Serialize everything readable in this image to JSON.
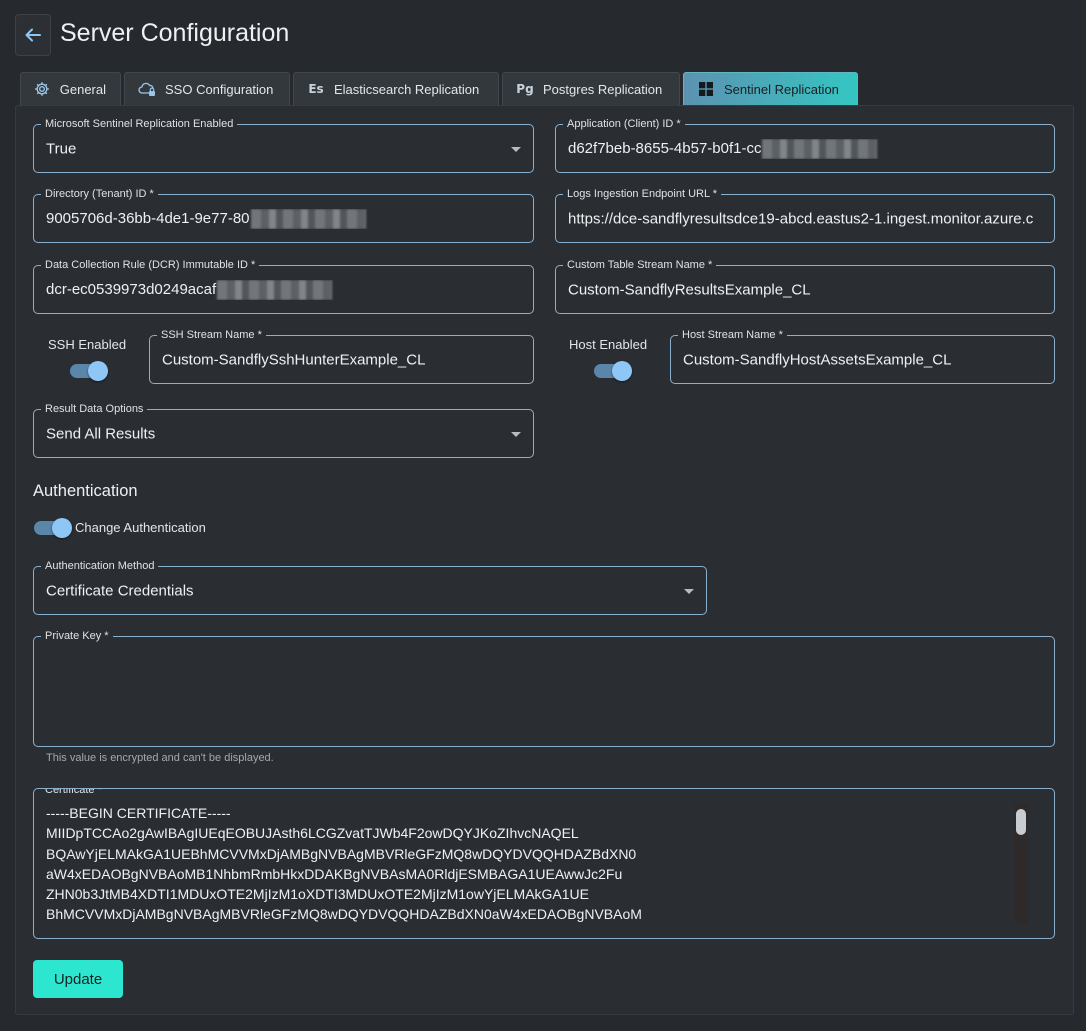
{
  "header": {
    "title": "Server Configuration"
  },
  "tabs": [
    {
      "label": "General",
      "icon": "gear-icon"
    },
    {
      "label": "SSO Configuration",
      "icon": "cloud-lock-icon"
    },
    {
      "label": "Elasticsearch Replication",
      "icon": "elasticsearch-icon",
      "glyph": "Es"
    },
    {
      "label": "Postgres Replication",
      "icon": "postgres-icon",
      "glyph": "Pg"
    },
    {
      "label": "Sentinel Replication",
      "icon": "windows-icon",
      "active": true
    }
  ],
  "form": {
    "enabled": {
      "label": "Microsoft Sentinel Replication Enabled",
      "value": "True"
    },
    "client_id": {
      "label": "Application (Client) ID *",
      "value": "d62f7beb-8655-4b57-b0f1-cc"
    },
    "tenant_id": {
      "label": "Directory (Tenant) ID *",
      "value": "9005706d-36bb-4de1-9e77-80"
    },
    "endpoint": {
      "label": "Logs Ingestion Endpoint URL *",
      "value": "https://dce-sandflyresultsdce19-abcd.eastus2-1.ingest.monitor.azure.c"
    },
    "dcr_id": {
      "label": "Data Collection Rule (DCR) Immutable ID *",
      "value": "dcr-ec0539973d0249acaf"
    },
    "table_stream": {
      "label": "Custom Table Stream Name *",
      "value": "Custom-SandflyResultsExample_CL"
    },
    "ssh_enabled": {
      "label": "SSH Enabled",
      "on": true
    },
    "ssh_stream": {
      "label": "SSH Stream Name *",
      "value": "Custom-SandflySshHunterExample_CL"
    },
    "host_enabled": {
      "label": "Host Enabled",
      "on": true
    },
    "host_stream": {
      "label": "Host Stream Name *",
      "value": "Custom-SandflyHostAssetsExample_CL"
    },
    "result_options": {
      "label": "Result Data Options",
      "value": "Send All Results"
    }
  },
  "auth": {
    "title": "Authentication",
    "change_label": "Change Authentication",
    "change_on": true,
    "method": {
      "label": "Authentication Method",
      "value": "Certificate Credentials"
    },
    "private_key": {
      "label": "Private Key *",
      "value": "",
      "helper": "This value is encrypted and can't be displayed."
    },
    "certificate": {
      "label": "Certificate *",
      "value": "-----BEGIN CERTIFICATE-----\nMIIDpTCCAo2gAwIBAgIUEqEOBUJAsth6LCGZvatTJWb4F2owDQYJKoZIhvcNAQEL\nBQAwYjELMAkGA1UEBhMCVVMxDjAMBgNVBAgMBVRleGFzMQ8wDQYDVQQHDAZBdXN0\naW4xEDAOBgNVBAoMB1NhbmRmbHkxDDAKBgNVBAsMA0RldjESMBAGA1UEAwwJc2Fu\nZHN0b3JtMB4XDTI1MDUxOTE2MjIzM1oXDTI3MDUxOTE2MjIzM1owYjELMAkGA1UE\nBhMCVVMxDjAMBgNVBAgMBVRleGFzMQ8wDQYDVQQHDAZBdXN0aW4xEDAOBgNVBAoM"
    }
  },
  "actions": {
    "update_label": "Update"
  }
}
